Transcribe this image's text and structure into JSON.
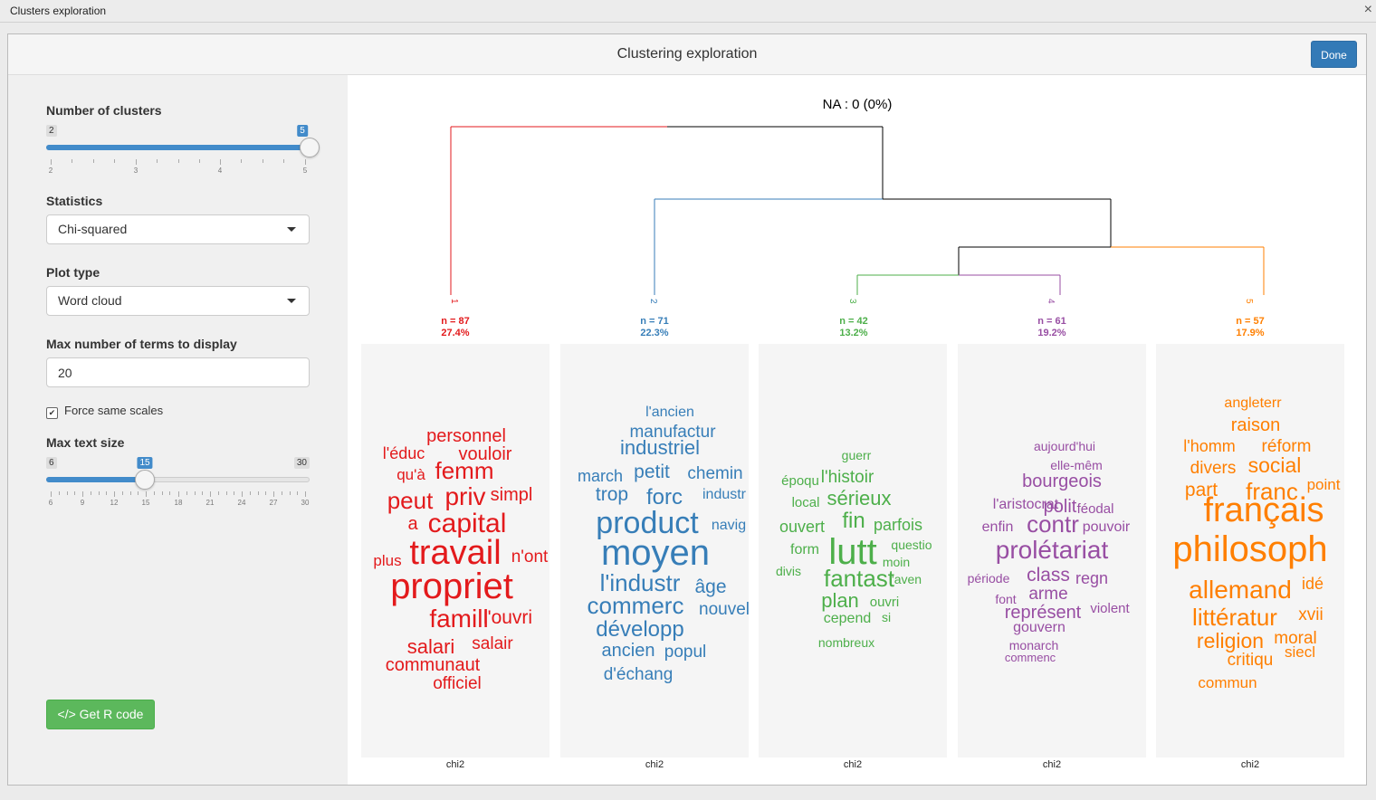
{
  "window": {
    "title": "Clusters exploration",
    "close_icon": "×"
  },
  "dialog": {
    "title": "Clustering exploration",
    "done_label": "Done"
  },
  "controls": {
    "n_clusters": {
      "label": "Number of clusters",
      "min": 2,
      "max": 5,
      "value": 5,
      "ticks": [
        "2",
        "3",
        "4",
        "5"
      ]
    },
    "statistics": {
      "label": "Statistics",
      "value": "Chi-squared"
    },
    "plot_type": {
      "label": "Plot type",
      "value": "Word cloud"
    },
    "max_terms": {
      "label": "Max number of terms to display",
      "value": "20"
    },
    "same_scales": {
      "label": "Force same scales",
      "checked": true
    },
    "max_text_size": {
      "label": "Max text size",
      "min": 6,
      "max": 30,
      "value": 15,
      "ticks": [
        "6",
        "9",
        "12",
        "15",
        "18",
        "21",
        "24",
        "27",
        "30"
      ]
    },
    "rcode_label": "Get R code"
  },
  "plot": {
    "na_label": "NA : 0 (0%)",
    "clusters": [
      {
        "id": "1",
        "n": "n = 87",
        "pct": "27.4%",
        "color": "#e31a1c",
        "stat": "chi2",
        "words": [
          {
            "t": "personnel",
            "s": 20
          },
          {
            "t": "l'éduc",
            "s": 18
          },
          {
            "t": "vouloir",
            "s": 20
          },
          {
            "t": "qu'à",
            "s": 17
          },
          {
            "t": "femm",
            "s": 26
          },
          {
            "t": "peut",
            "s": 26
          },
          {
            "t": "priv",
            "s": 28
          },
          {
            "t": "simpl",
            "s": 20
          },
          {
            "t": "a",
            "s": 20
          },
          {
            "t": "capital",
            "s": 30
          },
          {
            "t": "plus",
            "s": 17
          },
          {
            "t": "travail",
            "s": 38
          },
          {
            "t": "n'ont",
            "s": 19
          },
          {
            "t": "propriet",
            "s": 40
          },
          {
            "t": "famill",
            "s": 28
          },
          {
            "t": "l'ouvri",
            "s": 21
          },
          {
            "t": "salari",
            "s": 22
          },
          {
            "t": "salair",
            "s": 19
          },
          {
            "t": "communaut",
            "s": 20
          },
          {
            "t": "officiel",
            "s": 19
          }
        ]
      },
      {
        "id": "2",
        "n": "n = 71",
        "pct": "22.3%",
        "color": "#377eb8",
        "stat": "chi2",
        "words": [
          {
            "t": "l'ancien",
            "s": 16
          },
          {
            "t": "manufactur",
            "s": 19
          },
          {
            "t": "industriel",
            "s": 22
          },
          {
            "t": "march",
            "s": 18
          },
          {
            "t": "petit",
            "s": 21
          },
          {
            "t": "chemin",
            "s": 19
          },
          {
            "t": "trop",
            "s": 21
          },
          {
            "t": "forc",
            "s": 24
          },
          {
            "t": "industr",
            "s": 16
          },
          {
            "t": "product",
            "s": 34
          },
          {
            "t": "navig",
            "s": 16
          },
          {
            "t": "moyen",
            "s": 40
          },
          {
            "t": "l'industr",
            "s": 26
          },
          {
            "t": "âge",
            "s": 21
          },
          {
            "t": "commerc",
            "s": 26
          },
          {
            "t": "nouvel",
            "s": 19
          },
          {
            "t": "développ",
            "s": 24
          },
          {
            "t": "ancien",
            "s": 20
          },
          {
            "t": "popul",
            "s": 19
          },
          {
            "t": "d'échang",
            "s": 19
          }
        ]
      },
      {
        "id": "3",
        "n": "n = 42",
        "pct": "13.2%",
        "color": "#4daf4a",
        "stat": "chi2",
        "words": [
          {
            "t": "guerr",
            "s": 14
          },
          {
            "t": "époqu",
            "s": 15
          },
          {
            "t": "l'histoir",
            "s": 19
          },
          {
            "t": "local",
            "s": 15
          },
          {
            "t": "sérieux",
            "s": 22
          },
          {
            "t": "ouvert",
            "s": 18
          },
          {
            "t": "fin",
            "s": 24
          },
          {
            "t": "parfois",
            "s": 18
          },
          {
            "t": "form",
            "s": 16
          },
          {
            "t": "lutt",
            "s": 40
          },
          {
            "t": "questio",
            "s": 14
          },
          {
            "t": "moin",
            "s": 14
          },
          {
            "t": "divis",
            "s": 14
          },
          {
            "t": "fantast",
            "s": 26
          },
          {
            "t": "l'aven",
            "s": 14
          },
          {
            "t": "plan",
            "s": 22
          },
          {
            "t": "ouvri",
            "s": 15
          },
          {
            "t": "cepend",
            "s": 16
          },
          {
            "t": "si",
            "s": 14
          },
          {
            "t": "nombreux",
            "s": 14
          }
        ]
      },
      {
        "id": "4",
        "n": "n = 61",
        "pct": "19.2%",
        "color": "#984ea3",
        "stat": "chi2",
        "words": [
          {
            "t": "aujourd'hui",
            "s": 14
          },
          {
            "t": "elle-mêm",
            "s": 14
          },
          {
            "t": "bourgeois",
            "s": 20
          },
          {
            "t": "l'aristocrat",
            "s": 16
          },
          {
            "t": "polit",
            "s": 20
          },
          {
            "t": "féodal",
            "s": 15
          },
          {
            "t": "enfin",
            "s": 16
          },
          {
            "t": "contr",
            "s": 26
          },
          {
            "t": "pouvoir",
            "s": 16
          },
          {
            "t": "prolétariat",
            "s": 28
          },
          {
            "t": "période",
            "s": 14
          },
          {
            "t": "class",
            "s": 21
          },
          {
            "t": "regn",
            "s": 18
          },
          {
            "t": "font",
            "s": 14
          },
          {
            "t": "arme",
            "s": 19
          },
          {
            "t": "représent",
            "s": 20
          },
          {
            "t": "violent",
            "s": 15
          },
          {
            "t": "gouvern",
            "s": 16
          },
          {
            "t": "monarch",
            "s": 14
          },
          {
            "t": "commenc",
            "s": 13
          }
        ]
      },
      {
        "id": "5",
        "n": "n = 57",
        "pct": "17.9%",
        "color": "#ff7f00",
        "stat": "chi2",
        "words": [
          {
            "t": "angleterr",
            "s": 16
          },
          {
            "t": "raison",
            "s": 20
          },
          {
            "t": "l'homm",
            "s": 18
          },
          {
            "t": "réform",
            "s": 19
          },
          {
            "t": "divers",
            "s": 19
          },
          {
            "t": "social",
            "s": 23
          },
          {
            "t": "point",
            "s": 17
          },
          {
            "t": "part",
            "s": 21
          },
          {
            "t": "franc",
            "s": 26
          },
          {
            "t": "français",
            "s": 38
          },
          {
            "t": "philosoph",
            "s": 40
          },
          {
            "t": "allemand",
            "s": 28
          },
          {
            "t": "idé",
            "s": 18
          },
          {
            "t": "littératur",
            "s": 26
          },
          {
            "t": "xvii",
            "s": 19
          },
          {
            "t": "religion",
            "s": 23
          },
          {
            "t": "moral",
            "s": 19
          },
          {
            "t": "siecl",
            "s": 17
          },
          {
            "t": "critiqu",
            "s": 19
          },
          {
            "t": "commun",
            "s": 17
          }
        ]
      }
    ]
  }
}
